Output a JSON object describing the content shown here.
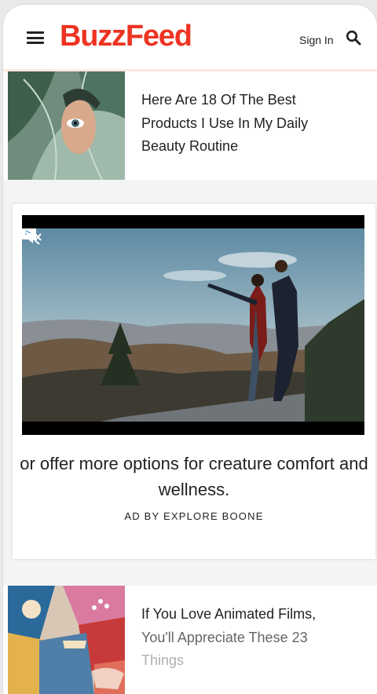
{
  "header": {
    "logo": "BuzzFeed",
    "sign_in": "Sign In",
    "icons": [
      "menu-icon",
      "search-icon"
    ]
  },
  "articles": [
    {
      "title": "Here Are 18 Of The Best Products I Use In My Daily Beauty Routine"
    },
    {
      "title_line1": "If You Love Animated Films,",
      "title_line2": "You'll Appreciate These 23",
      "title_line3": "Things"
    }
  ],
  "ad": {
    "text": "or offer more options for creature comfort and wellness.",
    "by": "AD BY EXPLORE BOONE",
    "icons": [
      "adchoices-icon",
      "mute-icon"
    ]
  },
  "colors": {
    "brand": "#ee3322",
    "text": "#222222"
  }
}
